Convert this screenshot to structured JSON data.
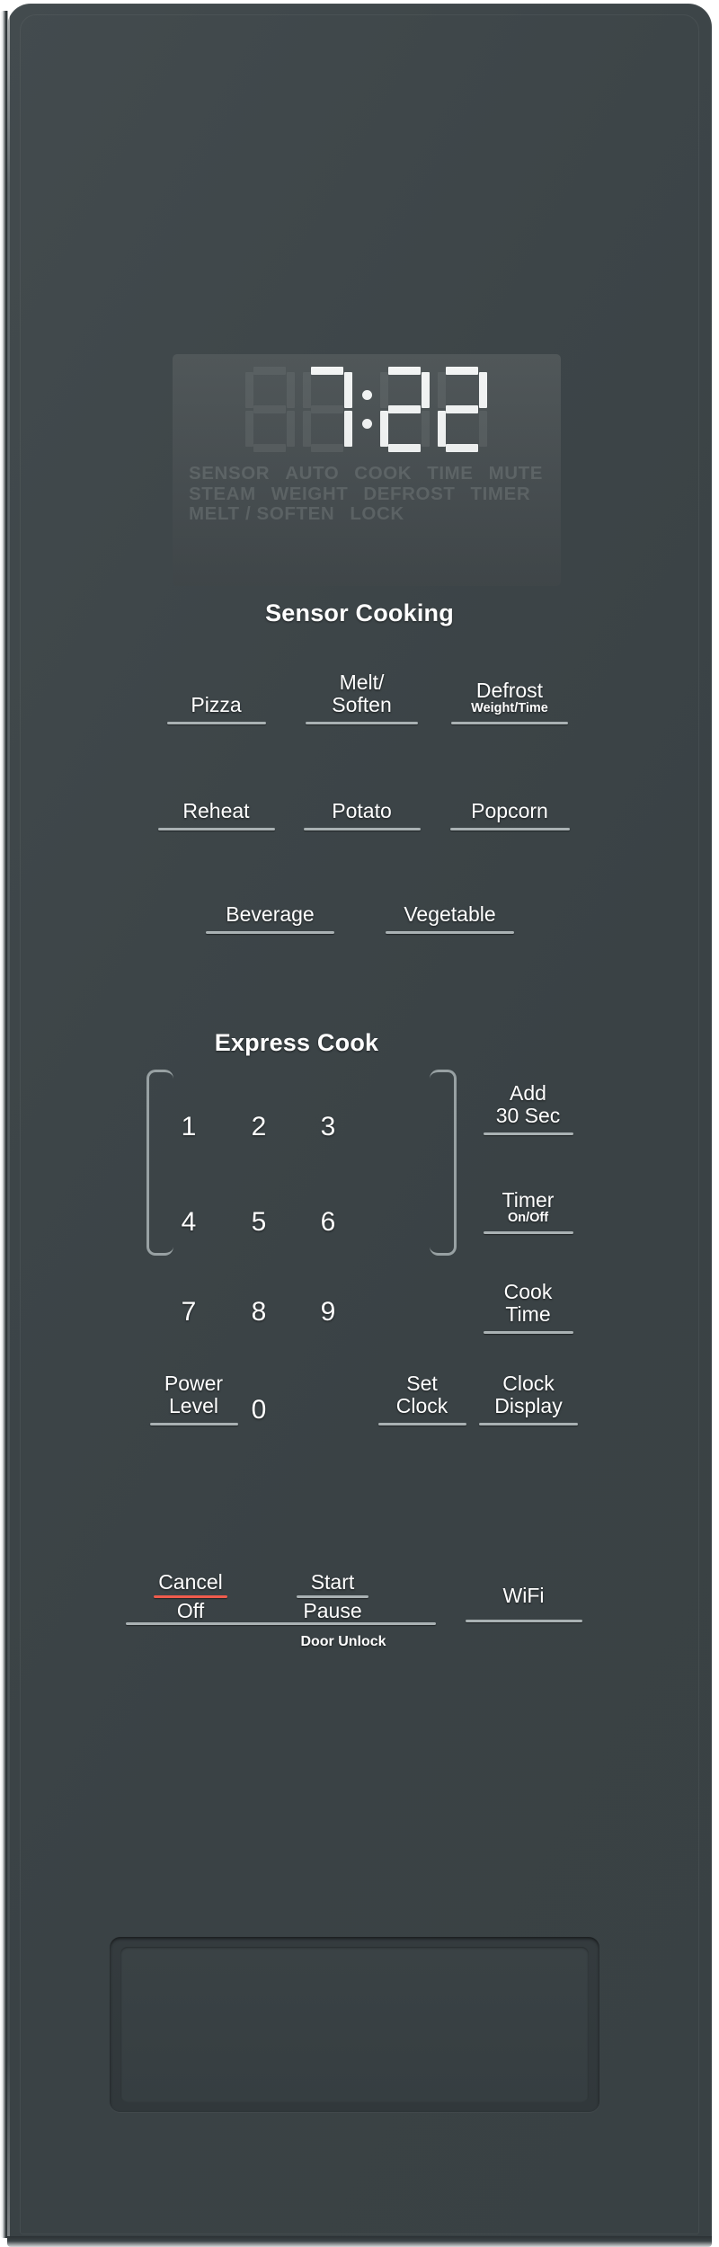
{
  "device": {
    "type": "microwave-control-panel",
    "body_color": "#3d4548",
    "accent_color": "#ef5b4c",
    "key_rule_color": "#a9b1b3"
  },
  "display": {
    "time": "7:22",
    "digits": [
      "8",
      "7",
      "2",
      "2"
    ],
    "digit_states": [
      "off",
      "on",
      "on",
      "on"
    ],
    "colon_on": true,
    "background": "#464d50",
    "segment_on_color": "#f2f4f4",
    "segment_off_color": "#545b5d",
    "indicator_rows": [
      [
        "SENSOR",
        "AUTO",
        "COOK",
        "TIME",
        "MUTE"
      ],
      [
        "STEAM",
        "WEIGHT",
        "DEFROST",
        "TIMER"
      ],
      [
        "MELT / SOFTEN",
        "LOCK"
      ]
    ],
    "indicator_color": "#5d6466"
  },
  "sensor_cooking": {
    "title": "Sensor Cooking",
    "keys": [
      {
        "label": "Pizza",
        "sub": ""
      },
      {
        "label": "Melt/",
        "label2": "Soften",
        "sub": ""
      },
      {
        "label": "Defrost",
        "sub": "Weight/Time"
      },
      {
        "label": "Reheat",
        "sub": ""
      },
      {
        "label": "Potato",
        "sub": ""
      },
      {
        "label": "Popcorn",
        "sub": ""
      },
      {
        "label": "Beverage",
        "sub": ""
      },
      {
        "label": "Vegetable",
        "sub": ""
      }
    ]
  },
  "express_cook": {
    "title": "Express Cook",
    "numbers": [
      "1",
      "2",
      "3",
      "4",
      "5",
      "6",
      "7",
      "8",
      "9",
      "0"
    ],
    "bracket_numbers": [
      "1",
      "2",
      "3",
      "4",
      "5",
      "6"
    ]
  },
  "function_keys": {
    "add_30_sec_line1": "Add",
    "add_30_sec_line2": "30 Sec",
    "timer_line1": "Timer",
    "timer_line2": "On/Off",
    "cook_time_line1": "Cook",
    "cook_time_line2": "Time",
    "clock_display_line1": "Clock",
    "clock_display_line2": "Display",
    "power_level_line1": "Power",
    "power_level_line2": "Level",
    "set_clock_line1": "Set",
    "set_clock_line2": "Clock"
  },
  "bottom_keys": {
    "cancel_line1": "Cancel",
    "cancel_line2": "Off",
    "start_line1": "Start",
    "start_line2": "Pause",
    "wifi": "WiFi",
    "door_unlock": "Door Unlock"
  }
}
